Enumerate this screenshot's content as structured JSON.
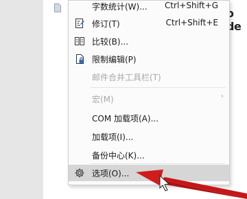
{
  "document": {
    "heading_fragment": "o de"
  },
  "menu": {
    "items": [
      {
        "label": "字数统计(W)...",
        "shortcut": "Ctrl+Shift+G"
      },
      {
        "label": "修订(T)",
        "shortcut": "Ctrl+Shift+E"
      },
      {
        "label": "比较(B)..."
      },
      {
        "label": "限制编辑(P)"
      },
      {
        "label": "邮件合并工具栏(T)"
      },
      {
        "label": "宏(M)"
      },
      {
        "label": "COM 加载项(A)..."
      },
      {
        "label": "加载项(I)..."
      },
      {
        "label": "备份中心(K)..."
      },
      {
        "label": "选项(O)..."
      }
    ]
  },
  "colors": {
    "annotation_arrow": "#d11c1c",
    "highlight": "#d6d6d6"
  }
}
